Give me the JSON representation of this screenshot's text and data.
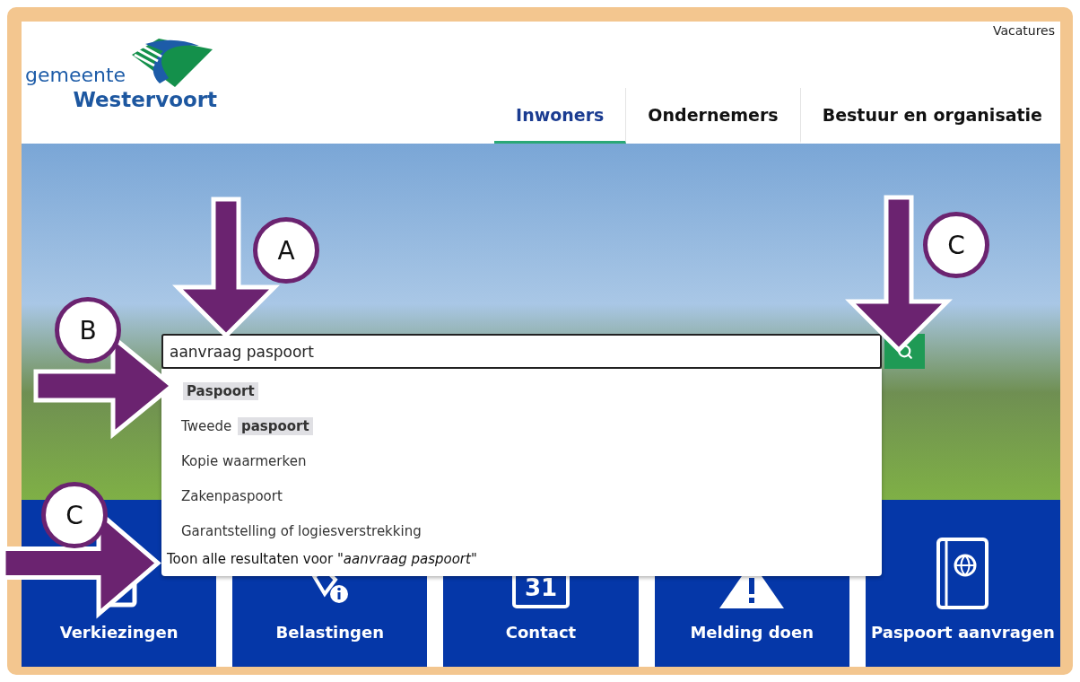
{
  "header": {
    "logo": {
      "line_1": "gemeente",
      "line_2": "Westervoort"
    },
    "top_link": "Vacatures",
    "nav": [
      {
        "label": "Inwoners",
        "selected": true
      },
      {
        "label": "Ondernemers",
        "selected": false
      },
      {
        "label": "Bestuur en organisatie",
        "selected": false
      }
    ]
  },
  "search": {
    "value": "aanvraag paspoort",
    "suggestions": [
      "**Paspoort**",
      "Tweede **paspoort**",
      "Kopie waarmerken",
      "Zakenpaspoort",
      "Garantstelling of logiesverstrekking"
    ],
    "all_results": "Toon alle resultaten voor \"*aanvraag paspoort*\""
  },
  "tiles": [
    {
      "kind": "ballot",
      "label": "Verkiezingen"
    },
    {
      "kind": "tax",
      "label": "Belastingen"
    },
    {
      "kind": "calendar",
      "label": "Contact",
      "icon_text": "31"
    },
    {
      "kind": "warning",
      "label": "Melding doen"
    },
    {
      "kind": "passport",
      "label": "Paspoort aanvragen"
    }
  ],
  "annotations": [
    {
      "label": "A",
      "kind": "down"
    },
    {
      "label": "B",
      "kind": "right"
    },
    {
      "label": "C",
      "kind": "down"
    },
    {
      "label": "C",
      "kind": "right"
    }
  ]
}
